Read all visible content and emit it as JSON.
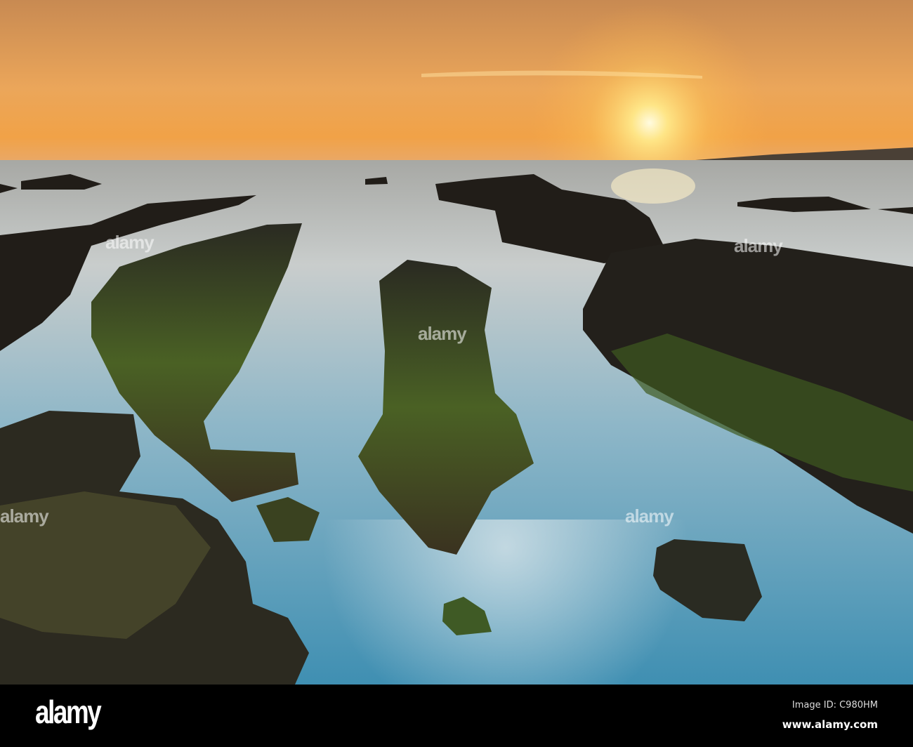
{
  "photo": {
    "subject": "sunset-over-rocky-tidal-pools"
  },
  "watermark": {
    "text": "alamy"
  },
  "footer": {
    "logo": "alamy",
    "image_id": "Image ID: C980HM",
    "url": "www.alamy.com"
  },
  "colors": {
    "sky_top": "#c98a4e",
    "sun": "#fff6c0",
    "water": "#6fa9c4",
    "rock": "#1f1c18",
    "moss": "#4f6a22"
  }
}
